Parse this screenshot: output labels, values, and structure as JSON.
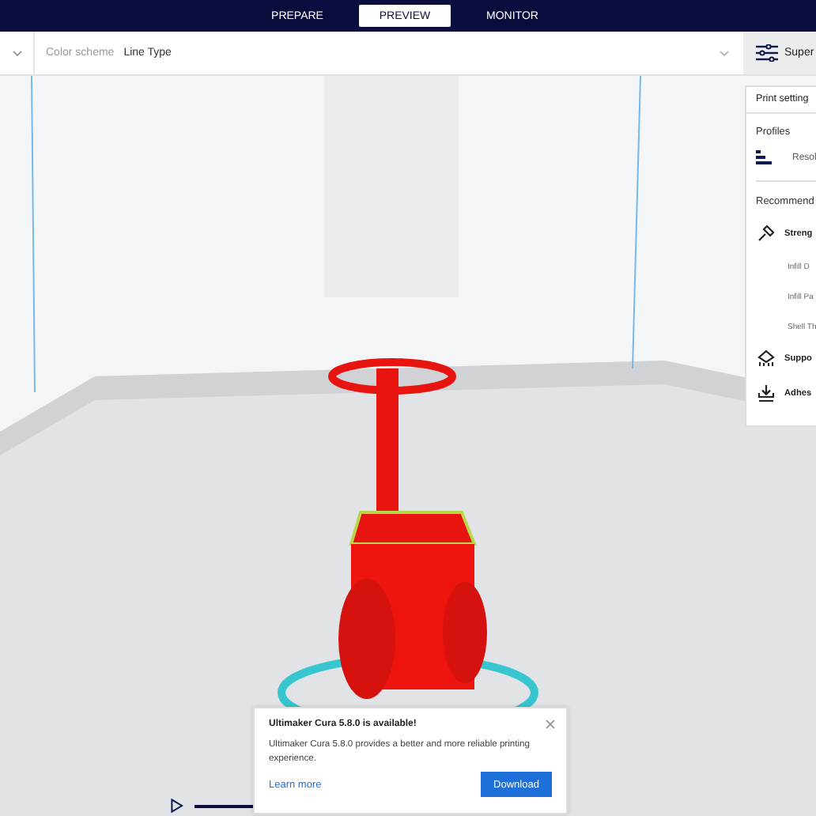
{
  "tabs": [
    {
      "label": "PREPARE",
      "selected": false
    },
    {
      "label": "PREVIEW",
      "selected": true
    },
    {
      "label": "MONITOR",
      "selected": false
    }
  ],
  "toolbar": {
    "color_scheme_label": "Color scheme",
    "color_scheme_value": "Line Type",
    "print_settings_button": "Super"
  },
  "print_settings": {
    "title": "Print setting",
    "profiles_label": "Profiles",
    "profile": "Resol",
    "recommended_label": "Recommend",
    "items": [
      {
        "kind": "header",
        "label": "Streng"
      },
      {
        "kind": "setting",
        "label": "Infill D"
      },
      {
        "kind": "setting",
        "label": "Infill Pa"
      },
      {
        "kind": "setting",
        "label": "Shell Th"
      },
      {
        "kind": "header",
        "label": "Suppo"
      },
      {
        "kind": "header",
        "label": "Adhes"
      }
    ]
  },
  "notification": {
    "title": "Ultimaker Cura 5.8.0 is available!",
    "body": "Ultimaker Cura 5.8.0 provides a better and more reliable printing experience.",
    "link": "Learn more",
    "button": "Download"
  }
}
